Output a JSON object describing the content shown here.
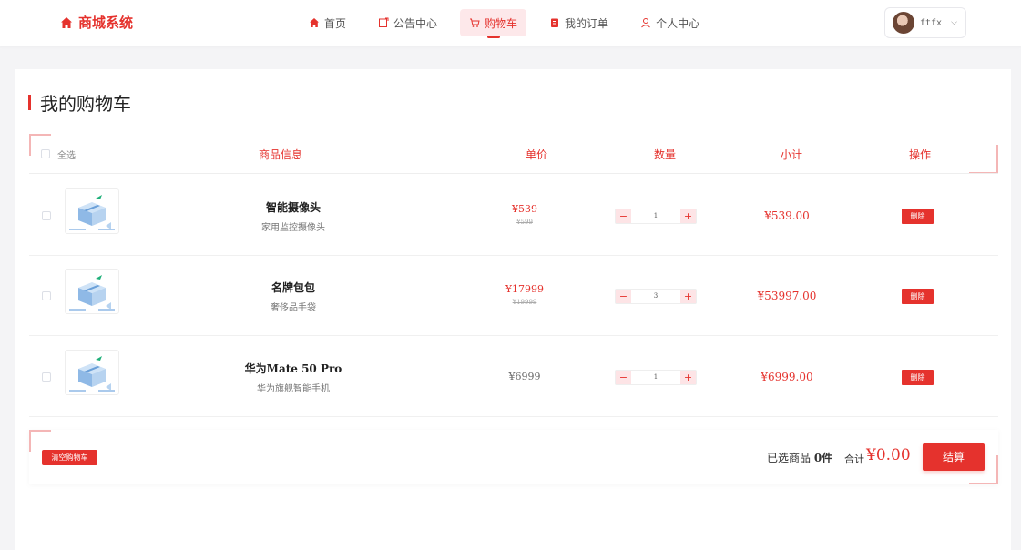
{
  "header": {
    "logo_text": "商城系统",
    "nav": [
      {
        "label": "首页",
        "icon": "home-icon"
      },
      {
        "label": "公告中心",
        "icon": "notice-icon"
      },
      {
        "label": "购物车",
        "icon": "cart-icon",
        "active": true
      },
      {
        "label": "我的订单",
        "icon": "order-icon"
      },
      {
        "label": "个人中心",
        "icon": "user-icon"
      }
    ],
    "user": {
      "name": "ftfx"
    }
  },
  "page": {
    "title": "我的购物车"
  },
  "table": {
    "select_all": "全选",
    "columns": [
      "商品信息",
      "单价",
      "数量",
      "小计",
      "操作"
    ]
  },
  "items": [
    {
      "name": "智能摄像头",
      "desc": "家用监控摄像头",
      "price": "¥539",
      "original_price": "¥599",
      "quantity": "1",
      "subtotal": "¥539.00",
      "delete_label": "删除"
    },
    {
      "name": "名牌包包",
      "desc": "奢侈品手袋",
      "price": "¥17999",
      "original_price": "¥19999",
      "quantity": "3",
      "subtotal": "¥53997.00",
      "delete_label": "删除"
    },
    {
      "name": "华为Mate 50 Pro",
      "desc": "华为旗舰智能手机",
      "price": "¥6999",
      "original_price": "",
      "quantity": "1",
      "subtotal": "¥6999.00",
      "delete_label": "删除"
    }
  ],
  "footer": {
    "clear_label": "清空购物车",
    "selected_prefix": "已选商品",
    "selected_count": "0件",
    "total_label": "合计",
    "total_value": "¥0.00",
    "checkout_label": "结算"
  },
  "colors": {
    "accent": "#e5322d",
    "accent_light": "#fde8ea"
  }
}
